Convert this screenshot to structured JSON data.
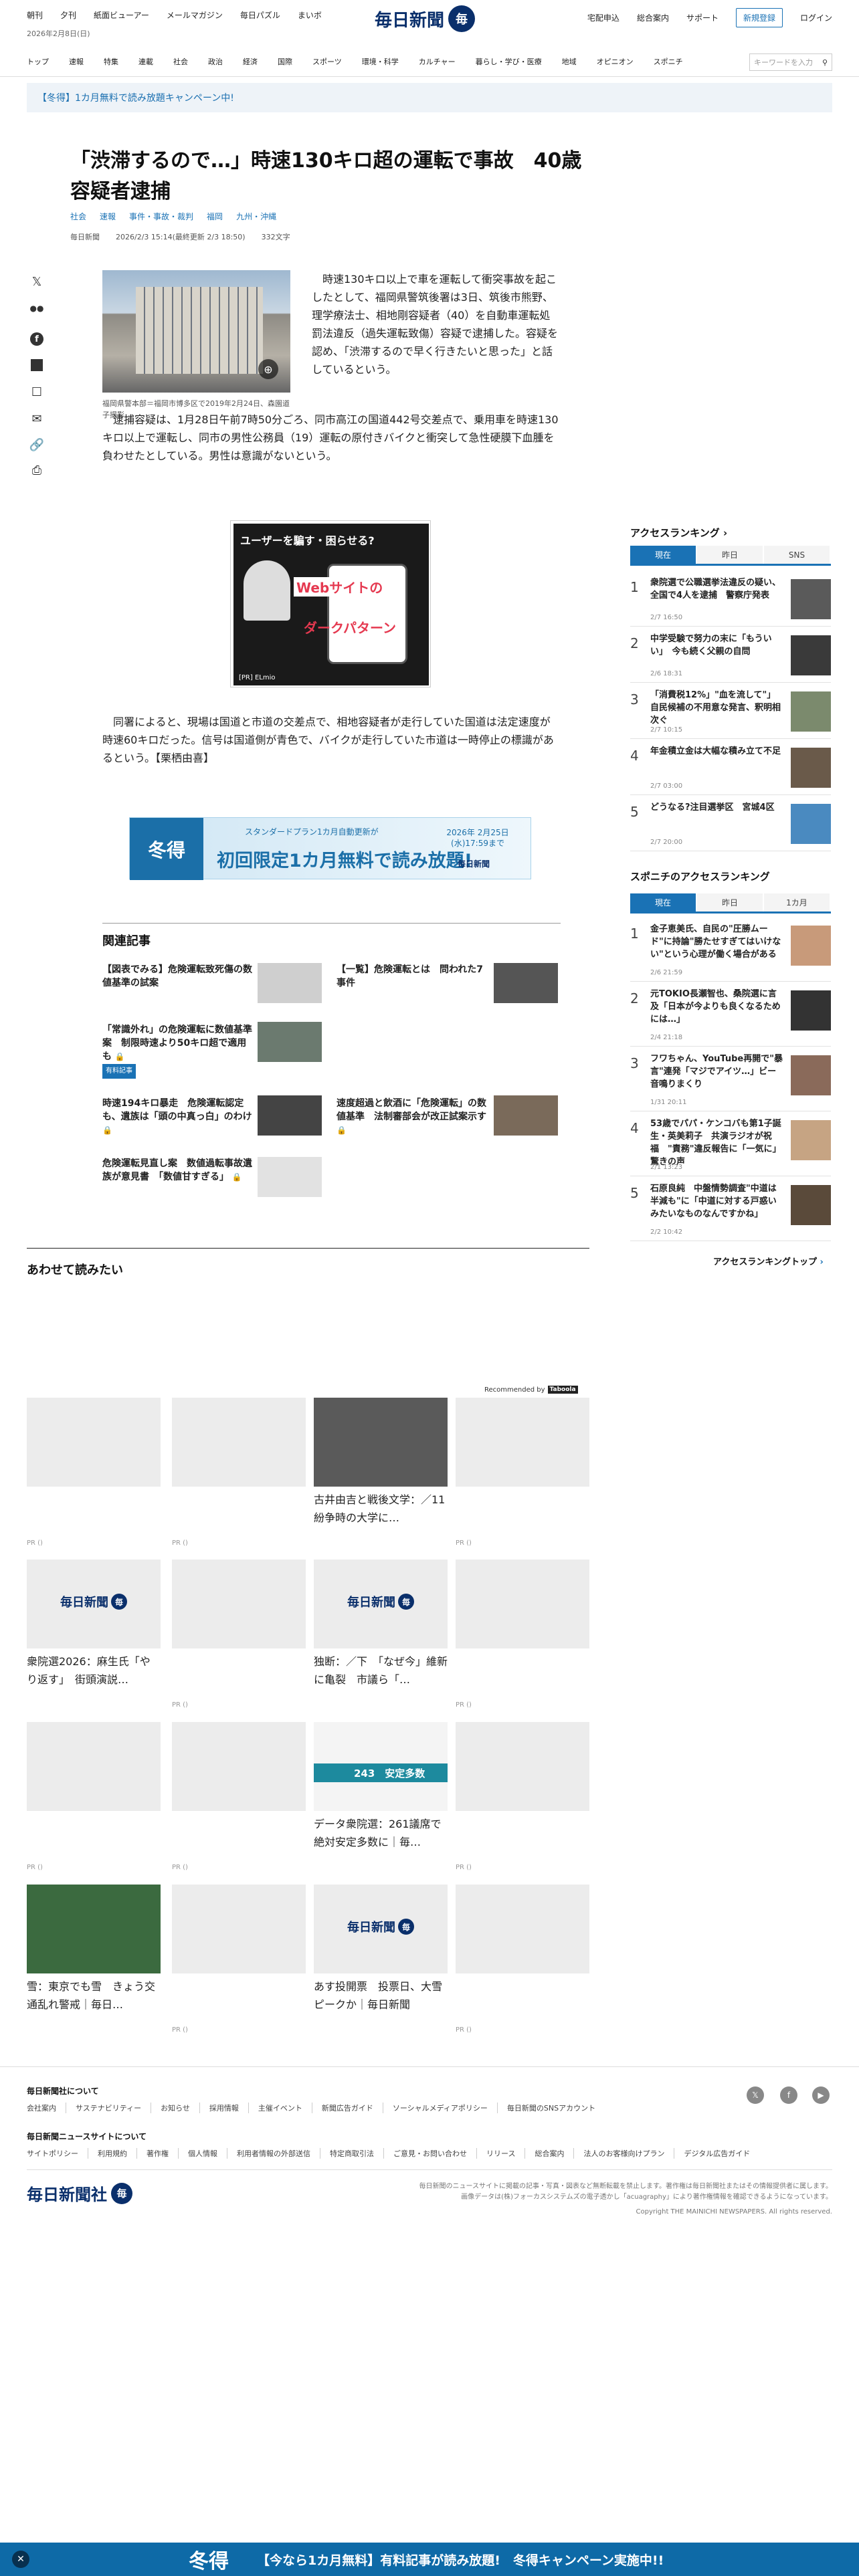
{
  "header": {
    "top_links": [
      "朝刊",
      "夕刊",
      "紙面ビューアー",
      "メールマガジン",
      "毎日パズル",
      "まいボ"
    ],
    "date": "2026年2月8日(日)",
    "logo_text": "毎日新聞",
    "right_links": [
      "宅配申込",
      "総合案内",
      "サポート"
    ],
    "register": "新規登録",
    "login": "ログイン",
    "nav": [
      "トップ",
      "速報",
      "特集",
      "連載",
      "社会",
      "政治",
      "経済",
      "国際",
      "スポーツ",
      "環境・科学",
      "カルチャー",
      "暮らし・学び・医療",
      "地域",
      "オピニオン",
      "スポニチ"
    ],
    "search_placeholder": "キーワードを入力"
  },
  "promo": "【冬得】1カ月無料で読み放題キャンペーン中!",
  "article": {
    "title": "「渋滞するので…」時速130キロ超の運転で事故　40歳容疑者逮捕",
    "categories": [
      "社会",
      "速報",
      "事件・事故・裁判",
      "福岡",
      "九州・沖縄"
    ],
    "source": "毎日新聞",
    "datetime": "2026/2/3 15:14(最終更新 2/3 18:50)",
    "chars": "332文字",
    "photo_caption": "福岡県警本部＝福岡市博多区で2019年2月24日、森園道子撮影",
    "p1": "　時速130キロ以上で車を運転して衝突事故を起こしたとして、福岡県警筑後署は3日、筑後市熊野、理学療法士、相地剛容疑者（40）を自動車運転処罰法違反（過失運転致傷）容疑で逮捕した。容疑を認め、「渋滞するので早く行きたいと思った」と話しているという。",
    "p2": "　逮捕容疑は、1月28日午前7時50分ごろ、同市高江の国道442号交差点で、乗用車を時速130キロ以上で運転し、同市の男性公務員（19）運転の原付きバイクと衝突して急性硬膜下血腫を負わせたとしている。男性は意識がないという。",
    "p3": "　同署によると、現場は国道と市道の交差点で、相地容疑者が走行していた国道は法定速度が時速60キロだった。信号は国道側が青色で、バイクが走行していた市道は一時停止の標識があるという。【栗栖由喜】"
  },
  "ad": {
    "headline": "ユーザーを騙す・困らせる?",
    "word1": "Webサイトの",
    "word2": "ダークパターン",
    "sponsor": "[PR] ELmio"
  },
  "banner": {
    "badge": "冬得",
    "line1": "スタンダードプラン1カ月自動更新が",
    "line2": "初回限定1カ月無料で読み放題!",
    "deadline": "2026年 2月25日(水)17:59まで",
    "logo": "毎日新聞"
  },
  "related": {
    "heading": "関連記事",
    "items": [
      {
        "text": "【図表でみる】危険運転致死傷の数値基準の試案",
        "tag": "",
        "lock": false
      },
      {
        "text": "【一覧】危険運転とは　問われた7事件",
        "tag": "",
        "lock": false
      },
      {
        "text": "「常識外れ」の危険運転に数値基準案　制限時速より50キロ超で適用も",
        "tag": "有料記事",
        "lock": true
      },
      {
        "text": "時速194キロ暴走　危険運転認定も、遺族は「頭の中真っ白」のわけ",
        "tag": "",
        "lock": true
      },
      {
        "text": "速度超過と飲酒に「危険運転」の数値基準　法制審部会が改正試案示す",
        "tag": "",
        "lock": true
      },
      {
        "text": "危険運転見直し案　数値過転事故遺族が意見書　「数値甘すぎる」",
        "tag": "",
        "lock": true
      }
    ]
  },
  "recommend": {
    "heading": "あわせて読みたい",
    "by": "Recommended by",
    "by_brand": "Taboola",
    "pr_label": "PR ()",
    "items": [
      {
        "title": "",
        "pr": true
      },
      {
        "title": "",
        "pr": true
      },
      {
        "title": "古井由吉と戦後文学：／11　紛争時の大学に…",
        "pr": false
      },
      {
        "title": "",
        "pr": true
      },
      {
        "title": "衆院選2026：麻生氏「やり返す」　街頭演説…",
        "pr": false,
        "logo": true
      },
      {
        "title": "",
        "pr": true
      },
      {
        "title": "独断：／下　「なぜ今」維新に亀裂　市議ら「…",
        "pr": false,
        "logo": true
      },
      {
        "title": "",
        "pr": true
      },
      {
        "title": "",
        "pr": true
      },
      {
        "title": "",
        "pr": true
      },
      {
        "title": "データ衆院選：261議席で絶対安定多数に｜毎…",
        "pr": false,
        "graphic": "243　安定多数"
      },
      {
        "title": "",
        "pr": true
      },
      {
        "title": "雪：東京でも雪　きょう交通乱れ警戒｜毎日…",
        "pr": false
      },
      {
        "title": "",
        "pr": true
      },
      {
        "title": "あす投開票　投票日、大雪ピークか｜毎日新聞",
        "pr": false,
        "logo": true
      },
      {
        "title": "",
        "pr": true
      }
    ]
  },
  "ranking": {
    "title": "アクセスランキング",
    "tabs": [
      "現在",
      "昨日",
      "SNS"
    ],
    "items": [
      {
        "rank": "1",
        "text": "衆院選で公職選挙法違反の疑い、全国で4人を逮捕　警察庁発表",
        "date": "2/7 16:50"
      },
      {
        "rank": "2",
        "text": "中学受験で努力の末に「もういい」　今も続く父親の自問",
        "date": "2/6 18:31"
      },
      {
        "rank": "3",
        "text": "「消費税12%」\"血を流して\"」自民候補の不用意な発言、釈明相次ぐ",
        "date": "2/7 10:15"
      },
      {
        "rank": "4",
        "text": "年金積立金は大幅な積み立て不足",
        "date": "2/7 03:00"
      },
      {
        "rank": "5",
        "text": "どうなる?注目選挙区　宮城4区",
        "date": "2/7 20:00"
      }
    ]
  },
  "sponichi": {
    "title": "スポニチのアクセスランキング",
    "tabs": [
      "現在",
      "昨日",
      "1カ月"
    ],
    "items": [
      {
        "rank": "1",
        "text": "金子恵美氏、自民の\"圧勝ムード\"に持論\"勝たせすぎてはいけない\"という心理が働く場合がある",
        "date": "2/6 21:59"
      },
      {
        "rank": "2",
        "text": "元TOKIO長瀬智也、桑院選に言及「日本が今よりも良くなるためには…」",
        "date": "2/4 21:18"
      },
      {
        "rank": "3",
        "text": "フワちゃん、YouTube再開で\"暴言\"連発「マジでアイツ…」ビー音鳴りまくり",
        "date": "1/31 20:11"
      },
      {
        "rank": "4",
        "text": "53歳でパパ・ケンコバも第1子誕生・英美莉子　共演ラジオが祝福　\"責務\"違反報告に「一気に」驚きの声",
        "date": "2/1 13:23"
      },
      {
        "rank": "5",
        "text": "石原良純　中盤情勢調査\"中道は半減も\"に「中道に対する戸惑いみたいなものなんですかね」",
        "date": "2/2 10:42"
      }
    ],
    "more": "アクセスランキングトップ"
  },
  "footer": {
    "h1": "毎日新聞社について",
    "links1": [
      "会社案内",
      "サステナビリティー",
      "お知らせ",
      "採用情報",
      "主催イベント",
      "新聞広告ガイド",
      "ソーシャルメディアポリシー",
      "毎日新聞のSNSアカウント"
    ],
    "h2": "毎日新聞ニュースサイトについて",
    "links2": [
      "サイトポリシー",
      "利用規約",
      "著作権",
      "個人情報",
      "利用者情報の外部送信",
      "特定商取引法",
      "ご意見・お問い合わせ",
      "リリース",
      "総合案内",
      "法人のお客様向けプラン",
      "デジタル広告ガイド"
    ],
    "logo": "毎日新聞社",
    "note1": "毎日新聞のニュースサイトに掲載の記事・写真・図表など無断転載を禁止します。著作権は毎日新聞社またはその情報提供者に属します。",
    "note2": "画像データは(株)フォーカスシステムズの電子透かし「acuagraphy」により著作権情報を確認できるようになっています。",
    "copyright": "Copyright THE MAINICHI NEWSPAPERS. All rights reserved."
  },
  "bottom_bar": {
    "badge": "冬得",
    "text": "【今なら1カ月無料】有料記事が読み放題!　冬得キャンペーン実施中!!"
  }
}
